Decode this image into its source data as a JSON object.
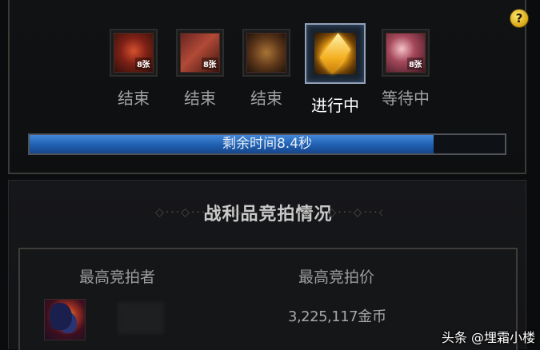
{
  "help": {
    "label": "?"
  },
  "items": [
    {
      "label": "结束",
      "badge": "8张",
      "state": "ended"
    },
    {
      "label": "结束",
      "badge": "8张",
      "state": "ended"
    },
    {
      "label": "结束",
      "badge": "",
      "state": "ended"
    },
    {
      "label": "进行中",
      "badge": "",
      "state": "in-progress"
    },
    {
      "label": "等待中",
      "badge": "8张",
      "state": "waiting"
    }
  ],
  "progress": {
    "text": "剩余时间8.4秒",
    "fraction": 0.85
  },
  "auction": {
    "title": "战利品竞拍情况",
    "col_bidder": "最高竞拍者",
    "col_price": "最高竞拍价",
    "price_value": "3,225,117",
    "price_unit": "金币"
  },
  "watermark": "头条 @埋霜小楼"
}
